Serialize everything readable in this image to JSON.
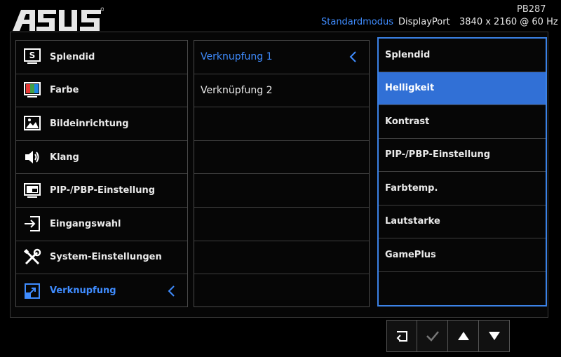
{
  "brand": {
    "logo_text": "ASUS"
  },
  "header": {
    "model": "PB287",
    "mode": "Standardmodus",
    "input": "DisplayPort",
    "resolution": "3840 x 2160 @ 60 Hz"
  },
  "main_menu": {
    "items": [
      {
        "label": "Splendid",
        "icon": "splendid-icon"
      },
      {
        "label": "Farbe",
        "icon": "color-icon"
      },
      {
        "label": "Bildeinrichtung",
        "icon": "image-icon"
      },
      {
        "label": "Klang",
        "icon": "speaker-icon"
      },
      {
        "label": "PIP-/PBP-Einstellung",
        "icon": "pip-icon"
      },
      {
        "label": "Eingangswahl",
        "icon": "input-icon"
      },
      {
        "label": "System-Einstellungen",
        "icon": "tools-icon"
      },
      {
        "label": "Verknupfung",
        "icon": "shortcut-icon",
        "selected": true
      }
    ]
  },
  "sub_menu": {
    "items": [
      {
        "label": "Verknupfung 1",
        "selected": true
      },
      {
        "label": "Verknüpfung 2"
      }
    ]
  },
  "options": {
    "items": [
      {
        "label": "Splendid"
      },
      {
        "label": "Helligkeit",
        "highlighted": true
      },
      {
        "label": "Kontrast"
      },
      {
        "label": "PIP-/PBP-Einstellung"
      },
      {
        "label": "Farbtemp."
      },
      {
        "label": "Lautstarke"
      },
      {
        "label": "GamePlus"
      }
    ]
  },
  "controls": {
    "buttons": [
      "back-icon",
      "check-icon",
      "up-arrow-icon",
      "down-arrow-icon"
    ]
  },
  "colors": {
    "accent": "#3f8cff",
    "highlight": "#3170d6",
    "background": "#000000"
  }
}
